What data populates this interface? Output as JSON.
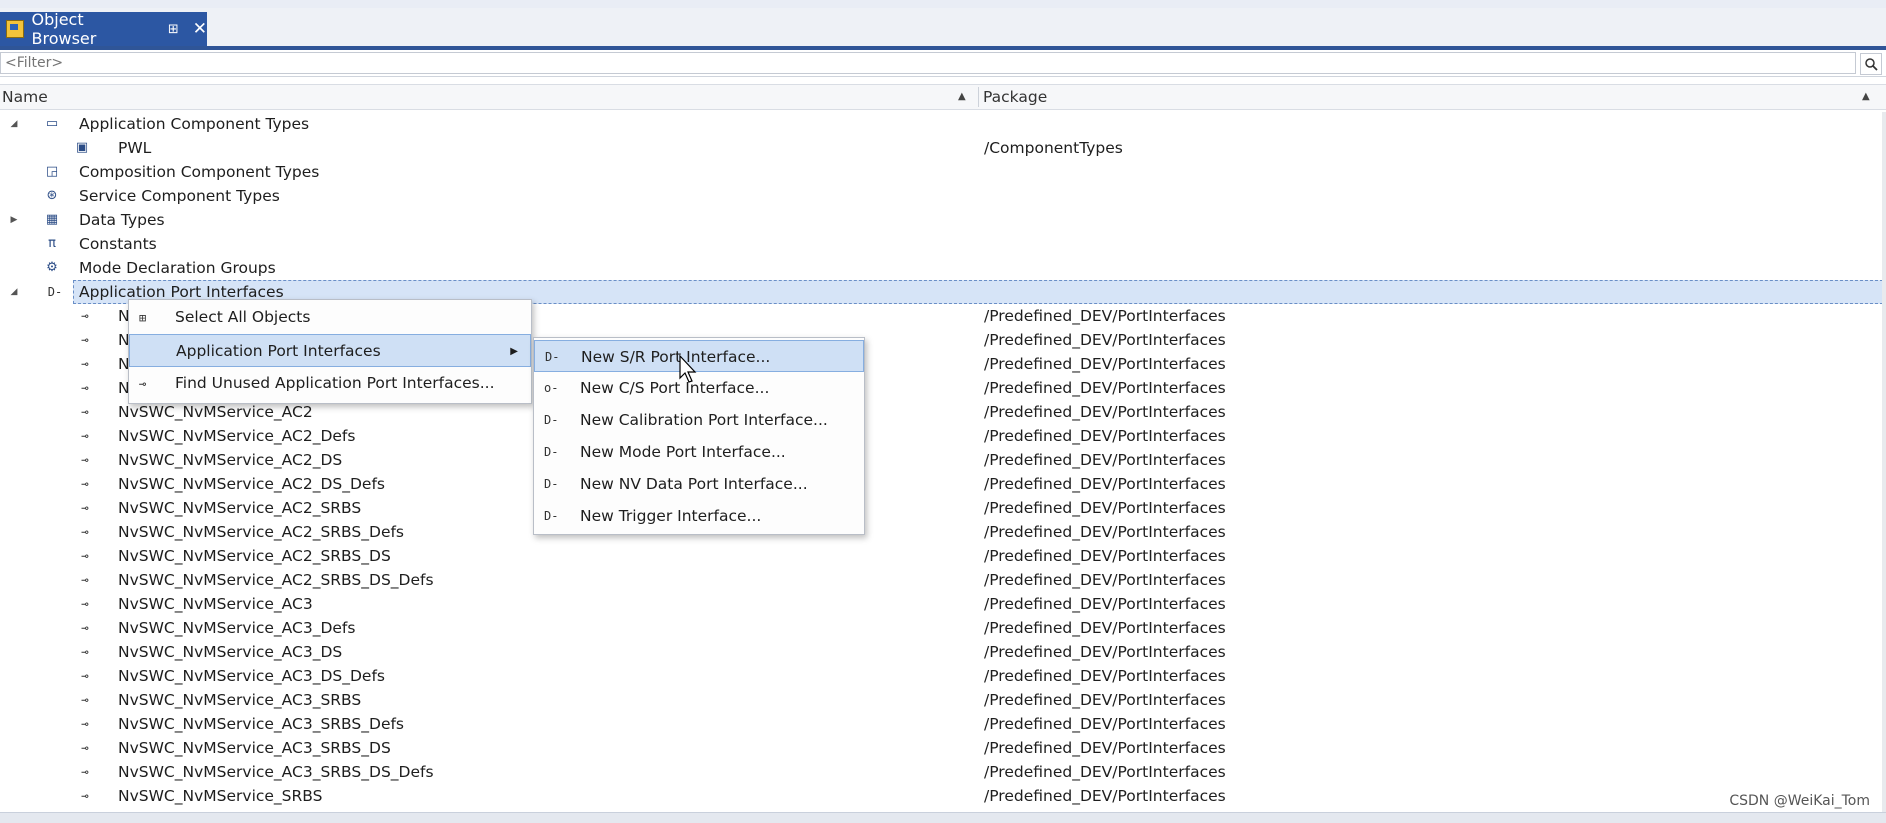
{
  "tab": {
    "title": "Object Browser",
    "pin_glyph": "⊞",
    "close_glyph": "✕"
  },
  "filter": {
    "placeholder": "<Filter>"
  },
  "columns": {
    "name": "Name",
    "package": "Package"
  },
  "tree": [
    {
      "label": "Application Component Types",
      "package": "",
      "icon": "component-types-icon",
      "expander": "expanded",
      "level": 0
    },
    {
      "label": "PWL",
      "package": "/ComponentTypes",
      "icon": "component-icon",
      "expander": "none",
      "level": 1
    },
    {
      "label": "Composition Component Types",
      "package": "",
      "icon": "composition-icon",
      "expander": "none",
      "level": 0
    },
    {
      "label": "Service Component Types",
      "package": "",
      "icon": "service-icon",
      "expander": "none",
      "level": 0
    },
    {
      "label": "Data Types",
      "package": "",
      "icon": "data-types-icon",
      "expander": "collapsed",
      "level": 0
    },
    {
      "label": "Constants",
      "package": "",
      "icon": "pi-icon",
      "expander": "none",
      "level": 0
    },
    {
      "label": "Mode Declaration Groups",
      "package": "",
      "icon": "mode-groups-icon",
      "expander": "none",
      "level": 0
    },
    {
      "label": "Application Port Interfaces",
      "package": "",
      "icon": "port-interfaces-icon",
      "expander": "expanded",
      "level": 0,
      "selected": true
    },
    {
      "label": "N",
      "package": "/Predefined_DEV/PortInterfaces",
      "icon": "port-interface-icon",
      "level": 1
    },
    {
      "label": "N",
      "package": "/Predefined_DEV/PortInterfaces",
      "icon": "port-interface-icon",
      "level": 1
    },
    {
      "label": "N",
      "package": "/Predefined_DEV/PortInterfaces",
      "icon": "port-interface-icon",
      "level": 1
    },
    {
      "label": "N",
      "package": "/Predefined_DEV/PortInterfaces",
      "icon": "port-interface-icon",
      "level": 1
    },
    {
      "label": "NvSWC_NvMService_AC2",
      "package": "/Predefined_DEV/PortInterfaces",
      "icon": "port-interface-icon",
      "level": 1
    },
    {
      "label": "NvSWC_NvMService_AC2_Defs",
      "package": "/Predefined_DEV/PortInterfaces",
      "icon": "port-interface-icon",
      "level": 1
    },
    {
      "label": "NvSWC_NvMService_AC2_DS",
      "package": "/Predefined_DEV/PortInterfaces",
      "icon": "port-interface-icon",
      "level": 1
    },
    {
      "label": "NvSWC_NvMService_AC2_DS_Defs",
      "package": "/Predefined_DEV/PortInterfaces",
      "icon": "port-interface-icon",
      "level": 1
    },
    {
      "label": "NvSWC_NvMService_AC2_SRBS",
      "package": "/Predefined_DEV/PortInterfaces",
      "icon": "port-interface-icon",
      "level": 1
    },
    {
      "label": "NvSWC_NvMService_AC2_SRBS_Defs",
      "package": "/Predefined_DEV/PortInterfaces",
      "icon": "port-interface-icon",
      "level": 1
    },
    {
      "label": "NvSWC_NvMService_AC2_SRBS_DS",
      "package": "/Predefined_DEV/PortInterfaces",
      "icon": "port-interface-icon",
      "level": 1
    },
    {
      "label": "NvSWC_NvMService_AC2_SRBS_DS_Defs",
      "package": "/Predefined_DEV/PortInterfaces",
      "icon": "port-interface-icon",
      "level": 1
    },
    {
      "label": "NvSWC_NvMService_AC3",
      "package": "/Predefined_DEV/PortInterfaces",
      "icon": "port-interface-icon",
      "level": 1
    },
    {
      "label": "NvSWC_NvMService_AC3_Defs",
      "package": "/Predefined_DEV/PortInterfaces",
      "icon": "port-interface-icon",
      "level": 1
    },
    {
      "label": "NvSWC_NvMService_AC3_DS",
      "package": "/Predefined_DEV/PortInterfaces",
      "icon": "port-interface-icon",
      "level": 1
    },
    {
      "label": "NvSWC_NvMService_AC3_DS_Defs",
      "package": "/Predefined_DEV/PortInterfaces",
      "icon": "port-interface-icon",
      "level": 1
    },
    {
      "label": "NvSWC_NvMService_AC3_SRBS",
      "package": "/Predefined_DEV/PortInterfaces",
      "icon": "port-interface-icon",
      "level": 1
    },
    {
      "label": "NvSWC_NvMService_AC3_SRBS_Defs",
      "package": "/Predefined_DEV/PortInterfaces",
      "icon": "port-interface-icon",
      "level": 1
    },
    {
      "label": "NvSWC_NvMService_AC3_SRBS_DS",
      "package": "/Predefined_DEV/PortInterfaces",
      "icon": "port-interface-icon",
      "level": 1
    },
    {
      "label": "NvSWC_NvMService_AC3_SRBS_DS_Defs",
      "package": "/Predefined_DEV/PortInterfaces",
      "icon": "port-interface-icon",
      "level": 1
    },
    {
      "label": "NvSWC_NvMService_SRBS",
      "package": "/Predefined_DEV/PortInterfaces",
      "icon": "port-interface-icon",
      "level": 1
    }
  ],
  "context_menu": [
    {
      "label": "Select All Objects",
      "icon": "select-all-icon"
    },
    {
      "label": "Application Port Interfaces",
      "icon": "",
      "has_submenu": true,
      "highlighted": true
    },
    {
      "label": "Find Unused Application Port Interfaces...",
      "icon": "port-interface-icon"
    }
  ],
  "submenu": [
    {
      "label": "New S/R Port Interface...",
      "icon": "sr-port-icon",
      "highlighted": true
    },
    {
      "label": "New C/S Port Interface...",
      "icon": "cs-port-icon"
    },
    {
      "label": "New Calibration Port Interface...",
      "icon": "calibration-port-icon"
    },
    {
      "label": "New Mode Port Interface...",
      "icon": "mode-port-icon"
    },
    {
      "label": "New NV Data Port Interface...",
      "icon": "nv-data-port-icon"
    },
    {
      "label": "New Trigger Interface...",
      "icon": "trigger-port-icon"
    }
  ],
  "watermark": "CSDN @WeiKai_Tom"
}
